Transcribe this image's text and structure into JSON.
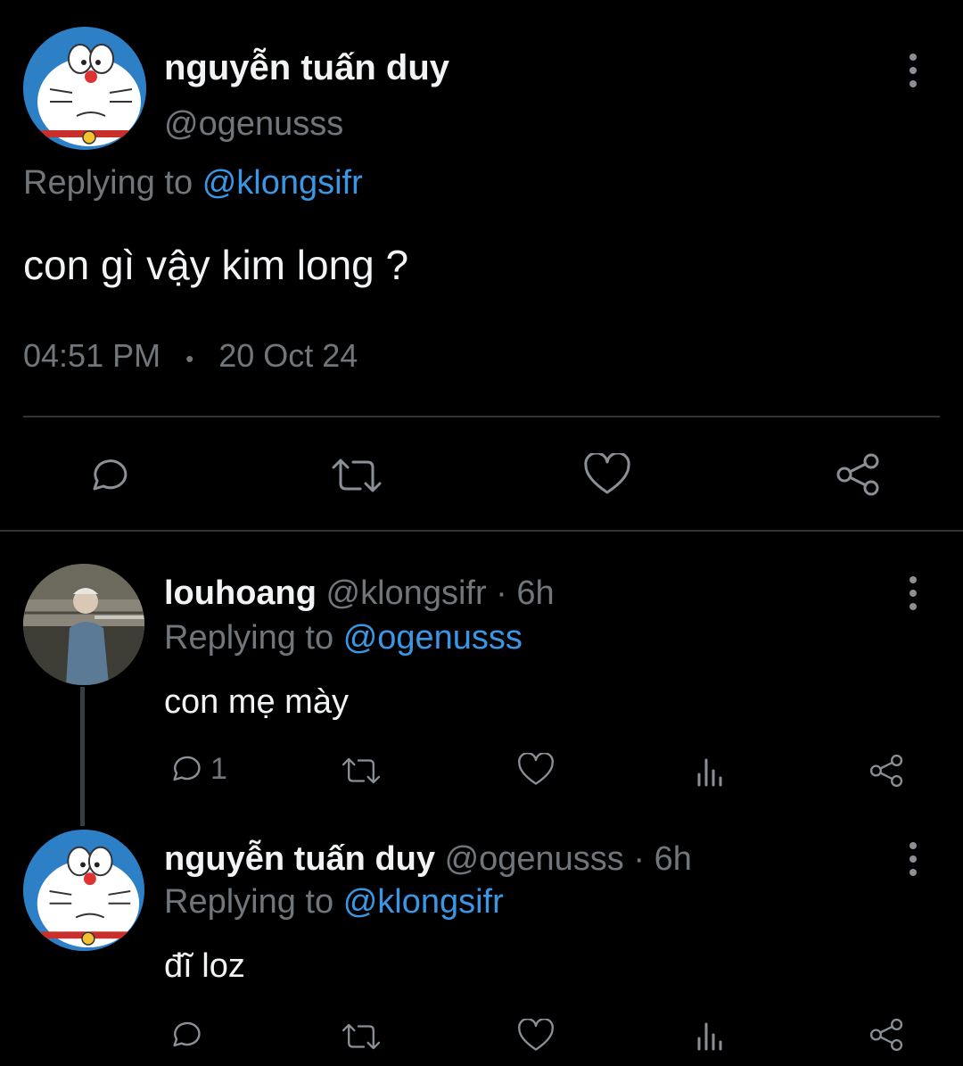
{
  "main_tweet": {
    "display_name": "nguyễn tuấn duy",
    "handle": "@ogenusss",
    "replying_label": "Replying to",
    "replying_to": "@klongsifr",
    "text": "con gì vậy kim long ?",
    "time": "04:51 PM",
    "dot": "•",
    "date": "20 Oct 24"
  },
  "replies": [
    {
      "display_name": "louhoang",
      "meta": "@klongsifr · 6h",
      "replying_label": "Replying to",
      "replying_to": "@ogenusss",
      "text": "con mẹ mày",
      "reply_count": "1"
    },
    {
      "display_name": "nguyễn tuấn duy",
      "meta": "@ogenusss · 6h",
      "replying_label": "Replying to",
      "replying_to": "@klongsifr",
      "text": "đĩ loz",
      "reply_count": ""
    }
  ],
  "icons": {
    "reply": "reply-icon",
    "retweet": "retweet-icon",
    "like": "heart-icon",
    "views": "views-icon",
    "share": "share-icon",
    "more": "more-icon"
  },
  "colors": {
    "background": "#000000",
    "link": "#3a97e6",
    "muted": "#71767b",
    "text": "#e7e9ea"
  }
}
